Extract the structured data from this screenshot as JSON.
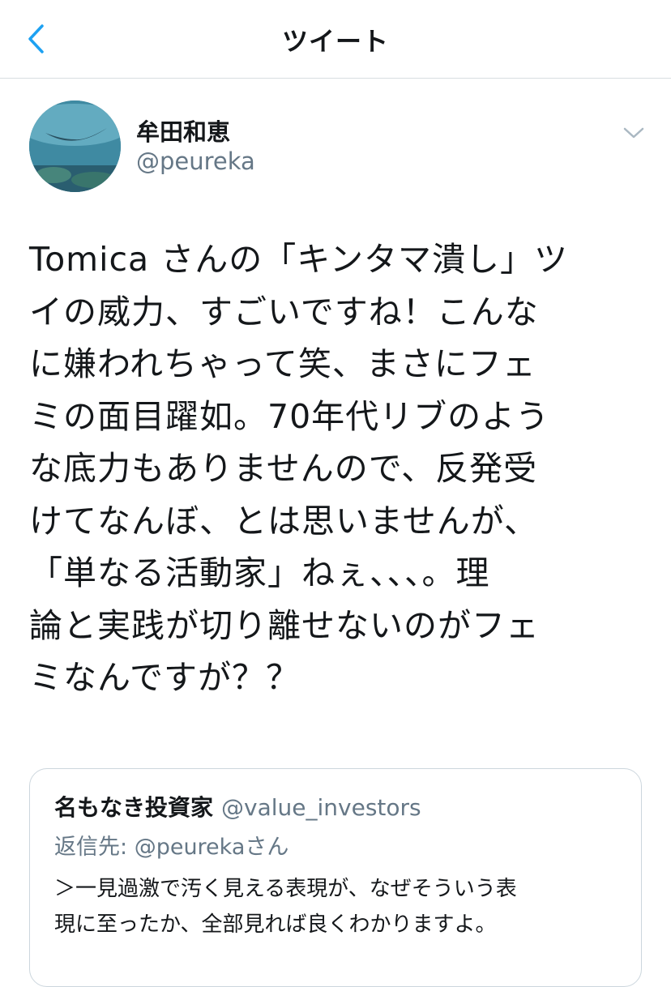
{
  "navbar": {
    "title": "ツイート",
    "back_icon": "chevron-left-icon",
    "accent_color": "#1da1f2"
  },
  "tweet": {
    "author": {
      "name": "牟田和恵",
      "handle": "@peureka"
    },
    "menu_icon": "chevron-down-icon",
    "text_lines": [
      "Tomica さんの「キンタマ潰し」ツ",
      "イの威力、すごいですね！こんな",
      "に嫌われちゃって笑、まさにフェ",
      "ミの面目躍如。70年代リブのよう",
      "な底力もありませんので、反発受",
      "けてなんぼ、とは思いませんが、",
      "「単なる活動家」ねぇ、、、。理",
      "論と実践が切り離せないのがフェ",
      "ミなんですが？？"
    ]
  },
  "quoted_tweet": {
    "author_name": "名もなき投資家",
    "author_handle": "@value_investors",
    "reply_prefix": "返信先: ",
    "reply_handle": "@peureka",
    "reply_suffix": "さん",
    "text_lines": [
      "＞一見過激で汚く見える表現が、なぜそういう表",
      "現に至ったか、全部見れば良くわかりますよ。"
    ]
  }
}
